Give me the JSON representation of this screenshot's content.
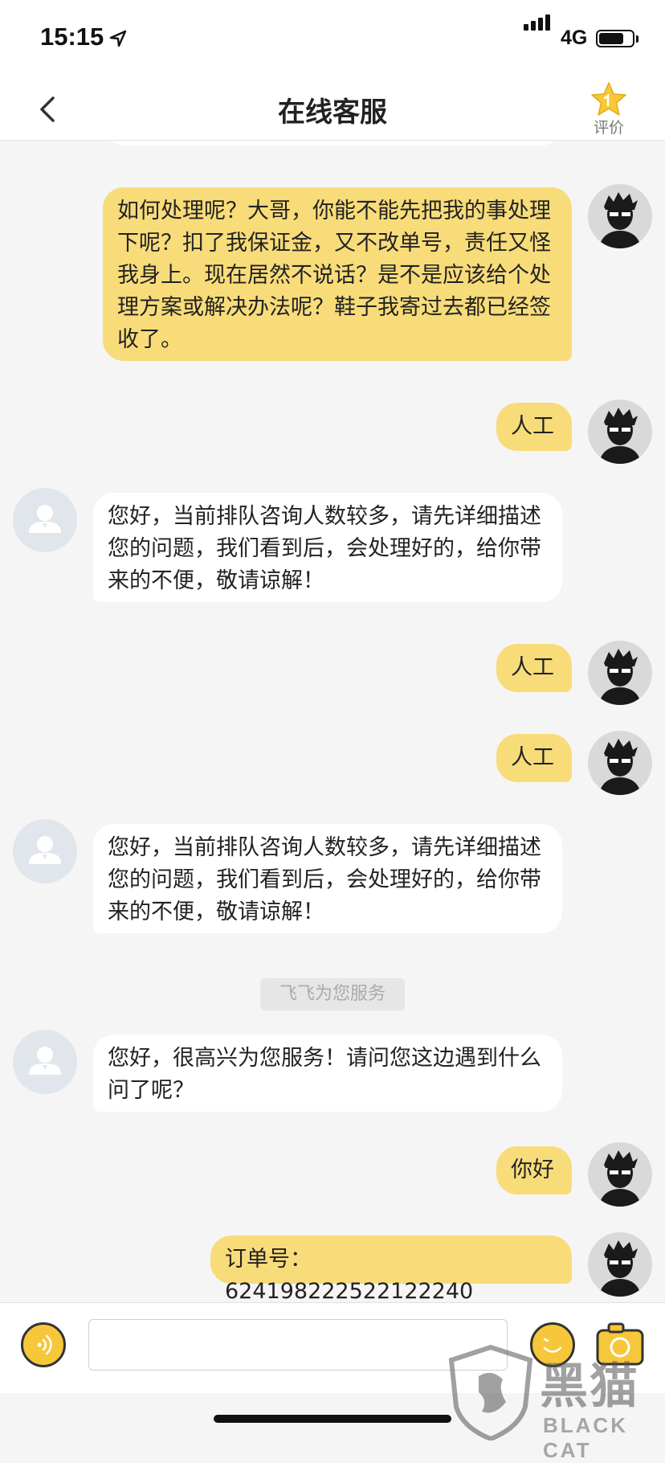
{
  "status_bar": {
    "time": "15:15",
    "network": "4G"
  },
  "header": {
    "title": "在线客服",
    "back_icon": "chevron-left-icon",
    "rate_label": "评价",
    "rate_icon": "star-icon"
  },
  "messages": [
    {
      "from": "me",
      "text": "如何处理呢？大哥，你能不能先把我的事处理下呢？扣了我保证金，又不改单号，责任又怪我身上。现在居然不说话？是不是应该给个处理方案或解决办法呢？鞋子我寄过去都已经签收了。"
    },
    {
      "from": "me",
      "text": "人工"
    },
    {
      "from": "cs",
      "text": "您好，当前排队咨询人数较多，请先详细描述您的问题，我们看到后，会处理好的，给你带来的不便，敬请谅解！"
    },
    {
      "from": "me",
      "text": "人工"
    },
    {
      "from": "me",
      "text": "人工"
    },
    {
      "from": "cs",
      "text": "您好，当前排队咨询人数较多，请先详细描述您的问题，我们看到后，会处理好的，给你带来的不便，敬请谅解！"
    },
    {
      "from": "system",
      "text": "飞飞为您服务"
    },
    {
      "from": "cs",
      "text": "您好，很高兴为您服务！请问您这边遇到什么问了呢？"
    },
    {
      "from": "me",
      "text": "你好"
    },
    {
      "from": "me",
      "text": "订单号：624198222522122240"
    }
  ],
  "input_bar": {
    "placeholder": "",
    "voice_icon": "voice-icon",
    "emoji_icon": "emoji-icon",
    "camera_icon": "camera-icon"
  },
  "watermark": {
    "text": "黑猫",
    "sub": "BLACK CAT"
  },
  "colors": {
    "accent": "#f8dc7a",
    "button": "#f6c73a",
    "background": "#f5f5f5"
  }
}
